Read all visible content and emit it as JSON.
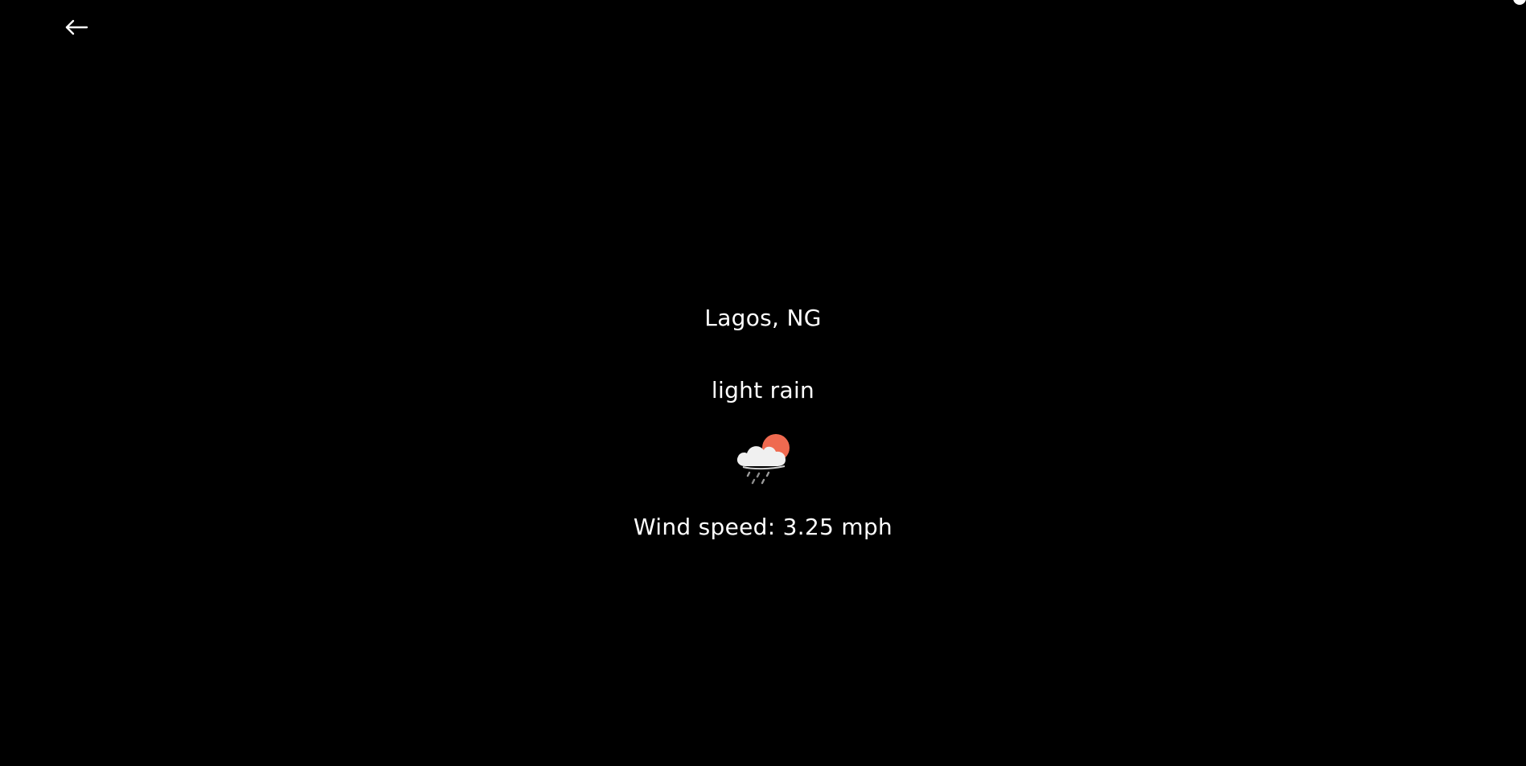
{
  "nav": {
    "back_icon": "arrow-left-icon"
  },
  "weather": {
    "location": "Lagos, NG",
    "description": "light rain",
    "icon": "cloud-sun-rain-icon",
    "wind_text": "Wind speed: 3.25 mph"
  },
  "colors": {
    "background": "#000000",
    "text": "#ffffff",
    "sun": "#ef6a50",
    "cloud": "#f0f0f0"
  }
}
